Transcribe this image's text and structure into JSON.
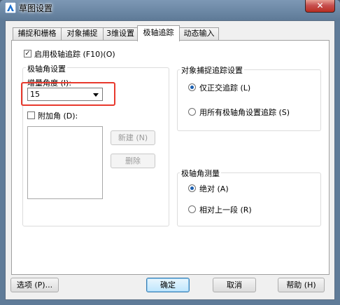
{
  "window": {
    "title": "草图设置",
    "close_symbol": "✕"
  },
  "tabs": [
    {
      "label": "捕捉和栅格",
      "active": false
    },
    {
      "label": "对象捕捉",
      "active": false
    },
    {
      "label": "3维设置",
      "active": false
    },
    {
      "label": "极轴追踪",
      "active": true
    },
    {
      "label": "动态输入",
      "active": false
    }
  ],
  "polar": {
    "enable_label": "启用极轴追踪 (F10)(O)",
    "enable_checked": true,
    "angle_group_title": "极轴角设置",
    "increment_label": "增量角度 (I):",
    "increment_value": "15",
    "additional_label": "附加角 (D):",
    "additional_checked": false,
    "new_button": "新建 (N)",
    "delete_button": "删除"
  },
  "snap_tracking": {
    "group_title": "对象捕捉追踪设置",
    "options": [
      {
        "label": "仅正交追踪 (L)",
        "selected": true
      },
      {
        "label": "用所有极轴角设置追踪 (S)",
        "selected": false
      }
    ]
  },
  "measurement": {
    "group_title": "极轴角测量",
    "options": [
      {
        "label": "绝对 (A)",
        "selected": true
      },
      {
        "label": "相对上一段 (R)",
        "selected": false
      }
    ]
  },
  "buttons": {
    "options": "选项 (P)...",
    "ok": "确定",
    "cancel": "取消",
    "help": "帮助 (H)"
  },
  "colors": {
    "highlight": "#e8392d",
    "radio_dot": "#1c5fb0",
    "default_button": "#3c7fb1"
  }
}
